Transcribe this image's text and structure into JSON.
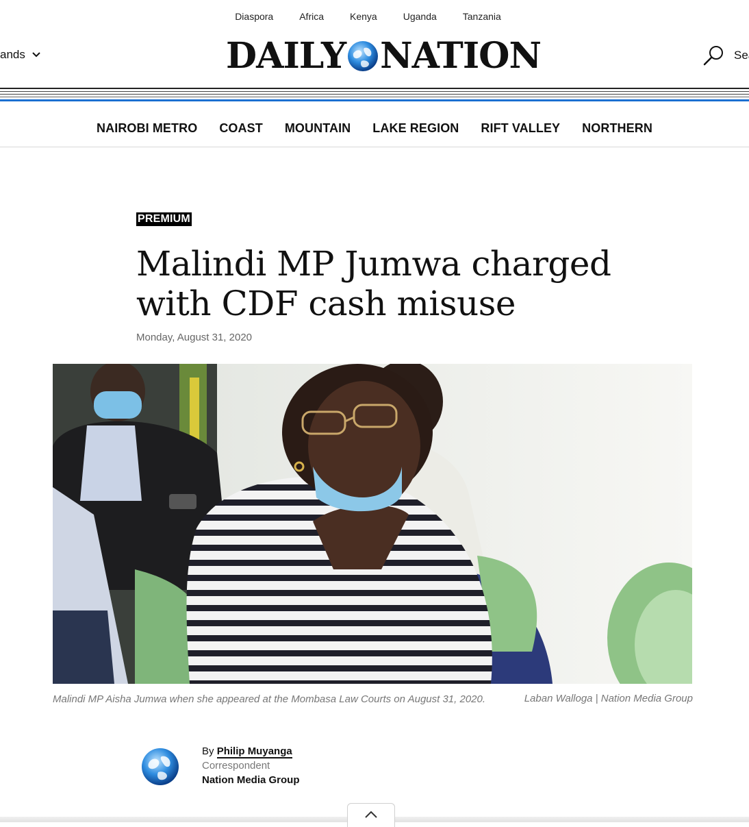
{
  "top_links": [
    "Diaspora",
    "Africa",
    "Kenya",
    "Uganda",
    "Tanzania"
  ],
  "brands_label": "ands",
  "logo": {
    "left": "DAILY",
    "right": "NATION"
  },
  "search_label": "Sea",
  "nav": [
    "NAIROBI METRO",
    "COAST",
    "MOUNTAIN",
    "LAKE REGION",
    "RIFT VALLEY",
    "NORTHERN"
  ],
  "article": {
    "badge": "PREMIUM",
    "headline": "Malindi MP Jumwa charged with CDF cash misuse",
    "date": "Monday, August 31, 2020",
    "caption": "Malindi MP Aisha Jumwa when she appeared at the Mombasa Law Courts on August 31, 2020.",
    "credit": "Laban Walloga | Nation Media Group",
    "byline_prefix": "By",
    "author": "Philip Muyanga",
    "role": "Correspondent",
    "organization": "Nation Media Group"
  },
  "colors": {
    "accent_blue": "#1b6fd1",
    "badge_bg": "#000000"
  }
}
